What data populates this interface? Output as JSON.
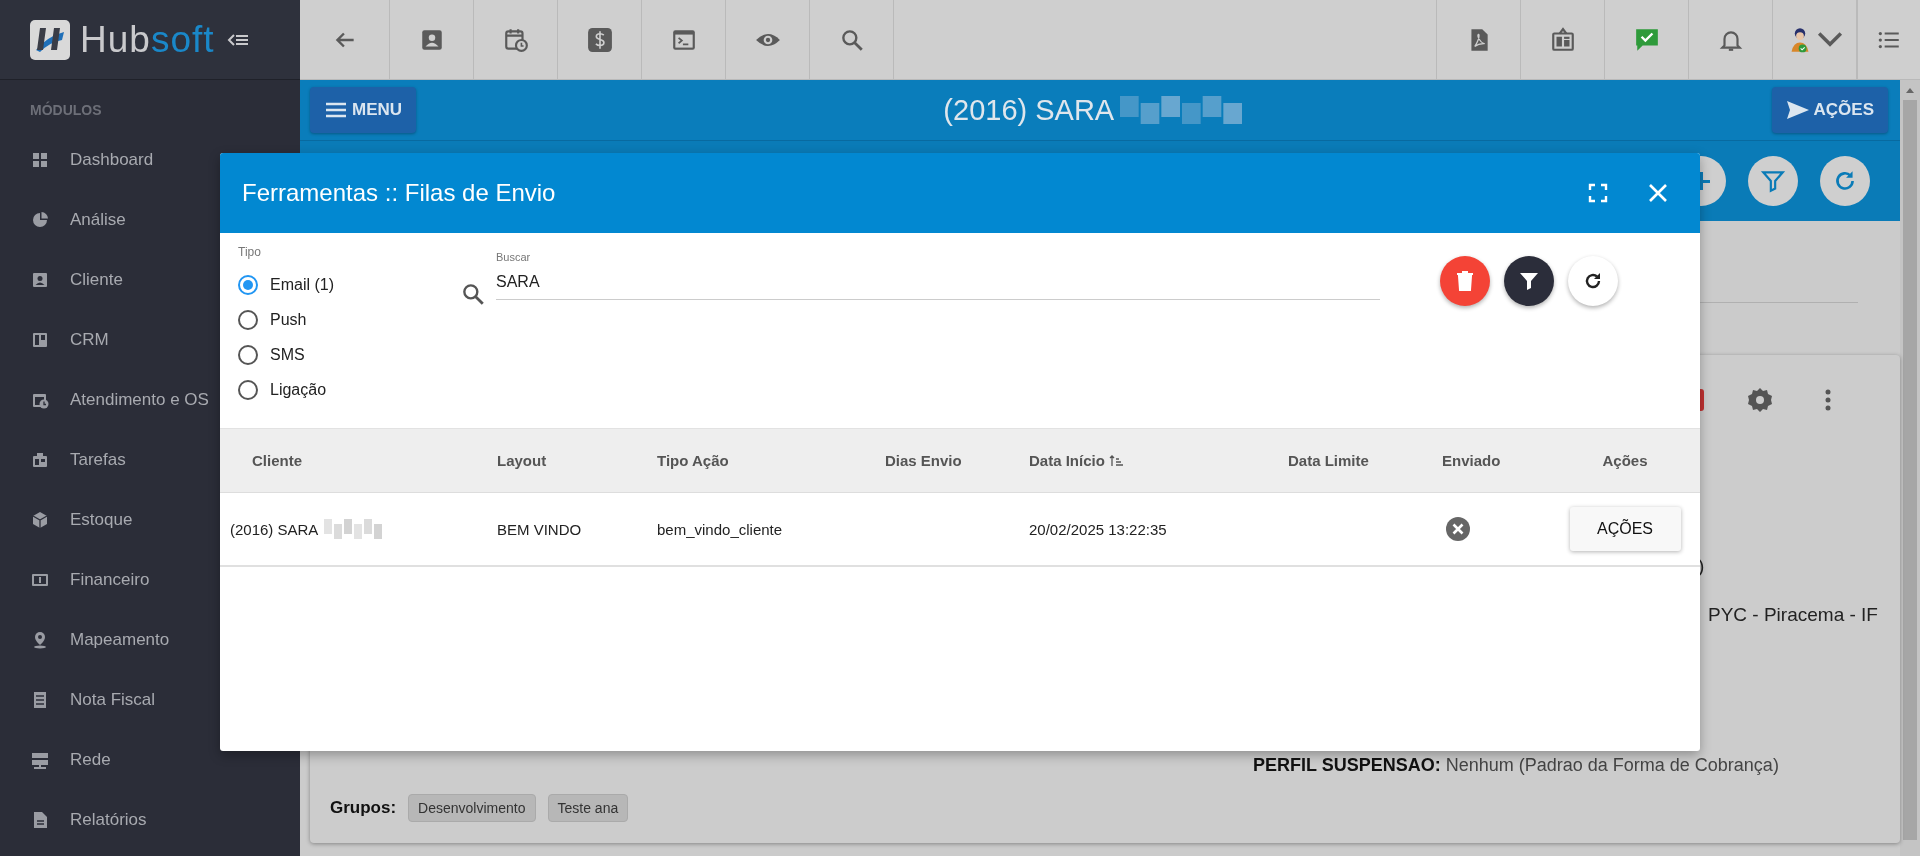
{
  "sidebar": {
    "brand": {
      "part_1": "Hub",
      "part_2": "soft"
    },
    "section_label": "MÓDULOS",
    "items": [
      {
        "label": "Dashboard"
      },
      {
        "label": "Análise"
      },
      {
        "label": "Cliente"
      },
      {
        "label": "CRM"
      },
      {
        "label": "Atendimento e OS"
      },
      {
        "label": "Tarefas"
      },
      {
        "label": "Estoque"
      },
      {
        "label": "Financeiro"
      },
      {
        "label": "Mapeamento"
      },
      {
        "label": "Nota Fiscal"
      },
      {
        "label": "Rede"
      },
      {
        "label": "Relatórios"
      }
    ]
  },
  "page_header": {
    "menu_button": "MENU",
    "title": "(2016) SARA",
    "actions_button": "AÇÕES"
  },
  "background_card": {
    "partial_lines": [
      ")",
      "PYC - Piracema - IF"
    ],
    "perfil": "**PERFIL SUSPENSAO:** Nenhum (Padrao da Forma de Cobrança)",
    "groups_label": "Grupos:",
    "groups": [
      "Desenvolvimento",
      "Teste ana"
    ]
  },
  "modal": {
    "title": "Ferramentas :: Filas de Envio",
    "tipo_label": "Tipo",
    "tipo_options": [
      {
        "label": "Email (1)",
        "selected": true
      },
      {
        "label": "Push",
        "selected": false
      },
      {
        "label": "SMS",
        "selected": false
      },
      {
        "label": "Ligação",
        "selected": false
      }
    ],
    "search": {
      "label": "Buscar",
      "value": "SARA"
    },
    "table": {
      "columns": [
        {
          "label": "Cliente",
          "sorted": false
        },
        {
          "label": "Layout",
          "sorted": false
        },
        {
          "label": "Tipo Ação",
          "sorted": false
        },
        {
          "label": "Dias Envio",
          "sorted": false
        },
        {
          "label": "Data Início",
          "sorted": true
        },
        {
          "label": "Data Limite",
          "sorted": false
        },
        {
          "label": "Enviado",
          "sorted": false
        },
        {
          "label": "Ações",
          "sorted": false
        }
      ],
      "rows": [
        {
          "cliente": "(2016) SARA",
          "layout": "BEM VINDO",
          "tipo_acao": "bem_vindo_cliente",
          "data_inicio": "20/02/2025 13:22:35",
          "enviado": false,
          "acoes_button": "AÇÕES"
        }
      ]
    }
  }
}
